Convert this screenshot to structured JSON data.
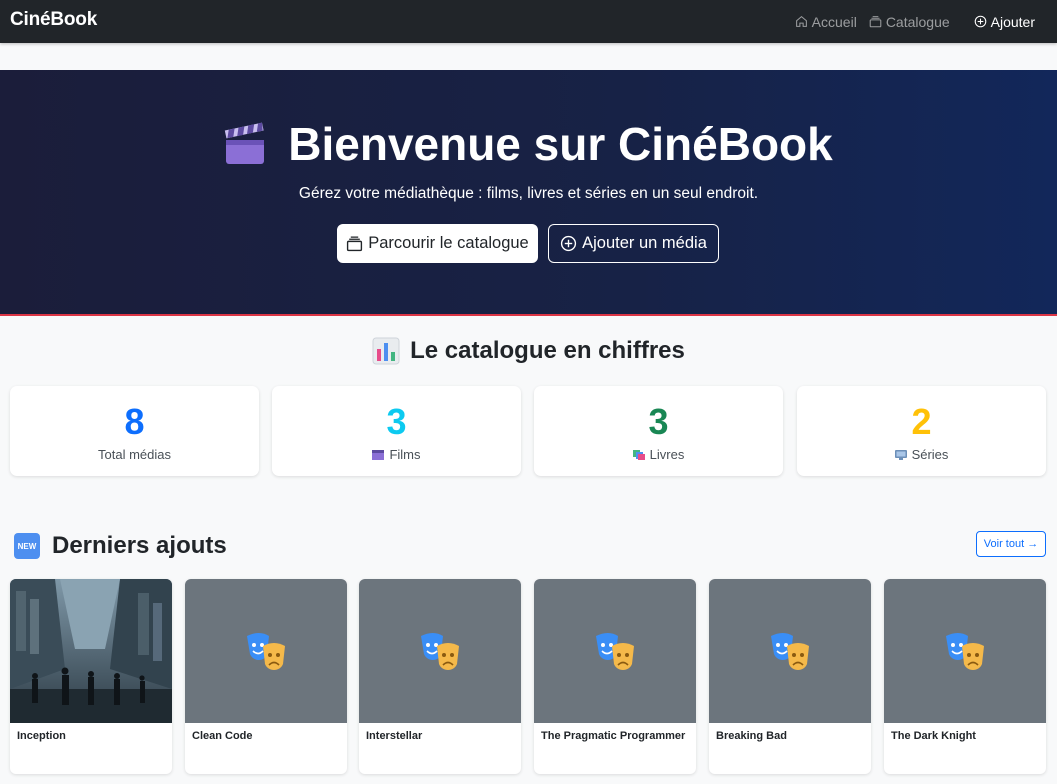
{
  "navbar": {
    "brand": "CinéBook",
    "links": [
      {
        "label": "Accueil",
        "icon": "home-icon"
      },
      {
        "label": "Catalogue",
        "icon": "collection-icon"
      },
      {
        "label": "Ajouter",
        "icon": "plus-circle-icon"
      }
    ]
  },
  "hero": {
    "title": "Bienvenue sur CinéBook",
    "title_icon": "clapperboard-icon",
    "subtitle": "Gérez votre médiathèque : films, livres et séries en un seul endroit.",
    "browse_button": "Parcourir le catalogue",
    "add_button": "Ajouter un média",
    "accent_color": "#dc3545"
  },
  "stats": {
    "title": "Le catalogue en chiffres",
    "title_icon": "bar-chart-icon",
    "cards": [
      {
        "value": "8",
        "label": "Total médias",
        "color": "#0d6efd",
        "icon": ""
      },
      {
        "value": "3",
        "label": "Films",
        "color": "#0dcaf0",
        "icon": "clapperboard-icon"
      },
      {
        "value": "3",
        "label": "Livres",
        "color": "#198754",
        "icon": "books-icon"
      },
      {
        "value": "2",
        "label": "Séries",
        "color": "#ffc107",
        "icon": "tv-icon"
      }
    ]
  },
  "latest": {
    "title": "Derniers ajouts",
    "badge": "NEW",
    "see_all": "Voir tout →",
    "items": [
      {
        "title": "Inception",
        "cover": "poster-image"
      },
      {
        "title": "Clean Code",
        "cover": "masks-icon"
      },
      {
        "title": "Interstellar",
        "cover": "masks-icon"
      },
      {
        "title": "The Pragmatic Programmer",
        "cover": "masks-icon"
      },
      {
        "title": "Breaking Bad",
        "cover": "masks-icon"
      },
      {
        "title": "The Dark Knight",
        "cover": "masks-icon"
      }
    ]
  }
}
